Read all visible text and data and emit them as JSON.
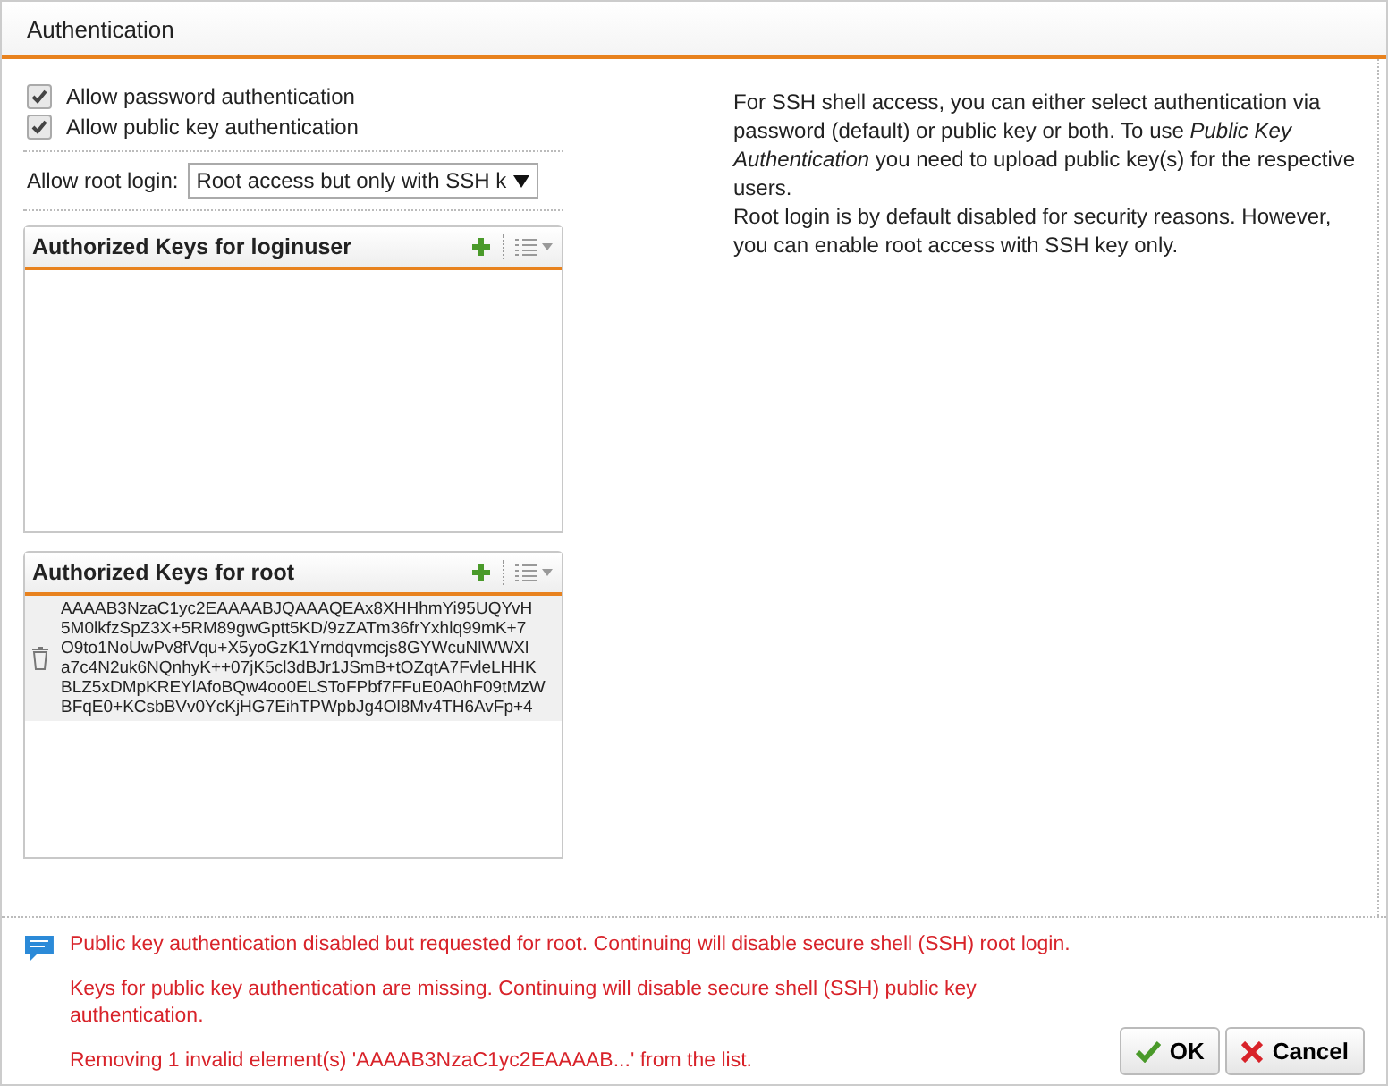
{
  "window": {
    "title": "Authentication"
  },
  "options": [
    {
      "label": "Allow password authentication",
      "checked": true
    },
    {
      "label": "Allow public key authentication",
      "checked": true
    }
  ],
  "root_login": {
    "label": "Allow root login:",
    "value": "Root access but only with SSH k"
  },
  "help": [
    "For SSH shell access, you can either select authentication via password (default) or public key or both. To use *Public Key Authentication* you need to upload public key(s) for the respective users.",
    "Root login is by default disabled for security reasons. However, you can enable root access with SSH key only."
  ],
  "key_panels": [
    {
      "title": "Authorized Keys for loginuser"
    },
    {
      "title": "Authorized Keys for root",
      "keys": [
        [
          "AAAAB3NzaC1yc2EAAAABJQAAAQEAx8XHHhmYi95UQYvH",
          "5M0lkfzSpZ3X+5RM89gwGptt5KD/9zZATm36frYxhlq99mK+7",
          "O9to1NoUwPv8fVqu+X5yoGzK1Yrndqvmcjs8GYWcuNlWWXl",
          "a7c4N2uk6NQnhyK++07jK5cl3dBJr1JSmB+tOZqtA7FvleLHHK",
          "BLZ5xDMpKREYlAfoBQw4oo0ELSToFPbf7FFuE0A0hF09tMzW",
          "BFqE0+KCsbBVv0YcKjHG7EihTPWpbJg4Ol8Mv4TH6AvFp+4"
        ]
      ]
    }
  ],
  "messages": [
    "Public key authentication disabled but requested for root. Continuing will disable secure shell (SSH) root login.",
    "Keys for public key authentication are missing. Continuing will disable secure shell (SSH) public key authentication.",
    "Removing 1 invalid element(s) 'AAAAB3NzaC1yc2EAAAAB...' from the list."
  ],
  "buttons": [
    {
      "kind": "ok",
      "label": "OK"
    },
    {
      "kind": "cancel",
      "label": "Cancel"
    }
  ]
}
